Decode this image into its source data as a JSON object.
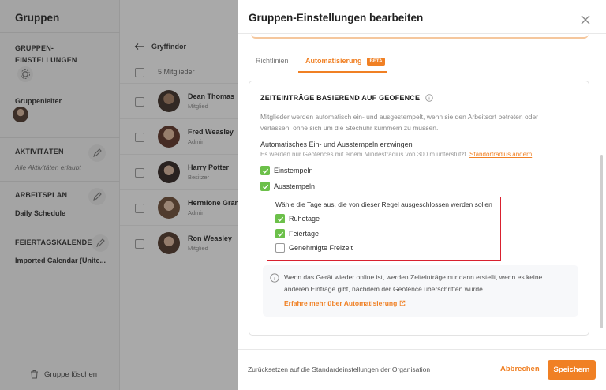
{
  "sidebar": {
    "title": "Gruppen",
    "settings_heading": "GRUPPEN-\nEINSTELLUNGEN",
    "leader_label": "Gruppenleiter",
    "activities": {
      "heading": "AKTIVITÄTEN",
      "value": "Alle Aktivitäten erlaubt"
    },
    "schedule": {
      "heading": "ARBEITSPLAN",
      "value": "Daily Schedule"
    },
    "holidays": {
      "heading": "FEIERTAGSKALENDER",
      "value": "Imported Calendar (Unite..."
    },
    "delete_label": "Gruppe löschen"
  },
  "members": {
    "group_name": "Gryffindor",
    "count_label": "5 Mitglieder",
    "rows": [
      {
        "name": "Dean Thomas",
        "role": "Mitglied"
      },
      {
        "name": "Fred Weasley",
        "role": "Admin"
      },
      {
        "name": "Harry Potter",
        "role": "Besitzer"
      },
      {
        "name": "Hermione Gran",
        "role": "Admin"
      },
      {
        "name": "Ron Weasley",
        "role": "Mitglied"
      }
    ]
  },
  "modal": {
    "title": "Gruppen-Einstellungen bearbeiten",
    "tabs": [
      {
        "label": "Richtlinien",
        "active": false
      },
      {
        "label": "Automatisierung",
        "active": true,
        "badge": "BETA"
      }
    ],
    "section": {
      "title": "ZEITEINTRÄGE BASIEREND AUF GEOFENCE",
      "description": "Mitglieder werden automatisch ein- und ausgestempelt, wenn sie den Arbeitsort betreten oder verlassen, ohne sich um die Stechuhr kümmern zu müssen.",
      "subheading": "Automatisches Ein- und Ausstempeln erzwingen",
      "note": "Es werden nur Geofences mit einem Mindestradius von 300 m unterstützt.",
      "note_link": "Standortradius ändern",
      "options": [
        {
          "label": "Einstempeln",
          "checked": true
        },
        {
          "label": "Ausstempeln",
          "checked": true
        }
      ],
      "exclude_title": "Wähle die Tage aus, die von dieser Regel ausgeschlossen werden sollen",
      "exclude_options": [
        {
          "label": "Ruhetage",
          "checked": true
        },
        {
          "label": "Feiertage",
          "checked": true
        },
        {
          "label": "Genehmigte Freizeit",
          "checked": false
        }
      ],
      "info_text": "Wenn das Gerät wieder online ist, werden Zeiteinträge nur dann erstellt, wenn es keine anderen Einträge gibt, nachdem der Geofence überschritten wurde.",
      "info_link": "Erfahre mehr über Automatisierung"
    },
    "footer": {
      "reset_label": "Zurücksetzen auf die Standardeinstellungen der Organisation",
      "cancel_label": "Abbrechen",
      "save_label": "Speichern"
    }
  },
  "colors": {
    "accent": "#f08024",
    "check_green": "#6cc04a",
    "highlight_red": "#d9212f"
  }
}
